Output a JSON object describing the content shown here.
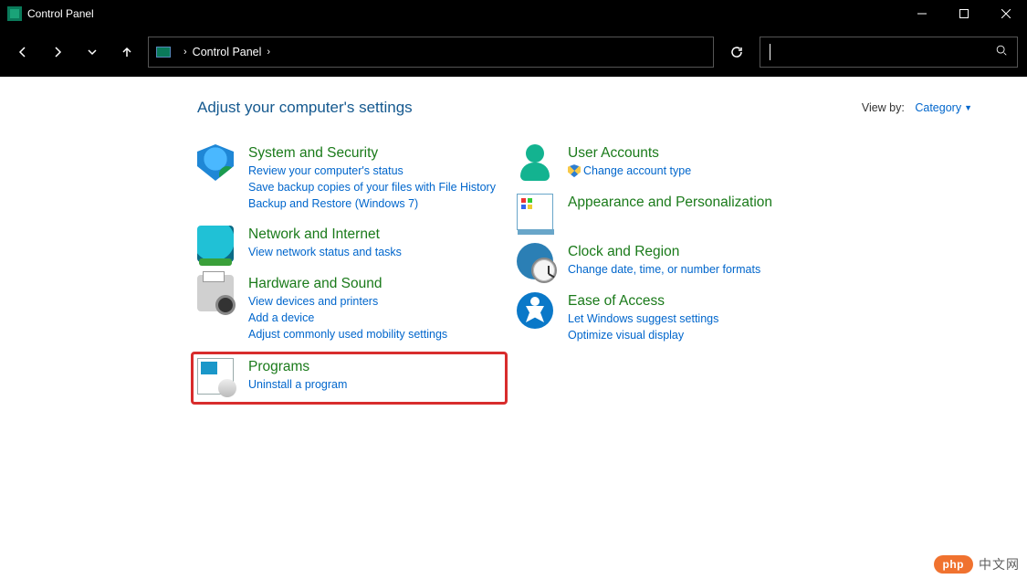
{
  "window": {
    "title": "Control Panel"
  },
  "breadcrumb": {
    "root": "Control Panel"
  },
  "heading": "Adjust your computer's settings",
  "viewby": {
    "label": "View by:",
    "value": "Category"
  },
  "left": [
    {
      "id": "system-security",
      "title": "System and Security",
      "links": [
        "Review your computer's status",
        "Save backup copies of your files with File History",
        "Backup and Restore (Windows 7)"
      ]
    },
    {
      "id": "network-internet",
      "title": "Network and Internet",
      "links": [
        "View network status and tasks"
      ]
    },
    {
      "id": "hardware-sound",
      "title": "Hardware and Sound",
      "links": [
        "View devices and printers",
        "Add a device",
        "Adjust commonly used mobility settings"
      ]
    },
    {
      "id": "programs",
      "title": "Programs",
      "links": [
        "Uninstall a program"
      ],
      "highlighted": true
    }
  ],
  "right": [
    {
      "id": "user-accounts",
      "title": "User Accounts",
      "links": [
        "Change account type"
      ],
      "shield_on": 0
    },
    {
      "id": "appearance",
      "title": "Appearance and Personalization",
      "links": []
    },
    {
      "id": "clock-region",
      "title": "Clock and Region",
      "links": [
        "Change date, time, or number formats"
      ]
    },
    {
      "id": "ease-of-access",
      "title": "Ease of Access",
      "links": [
        "Let Windows suggest settings",
        "Optimize visual display"
      ]
    }
  ],
  "watermark": {
    "pill": "php",
    "text": "中文网"
  }
}
